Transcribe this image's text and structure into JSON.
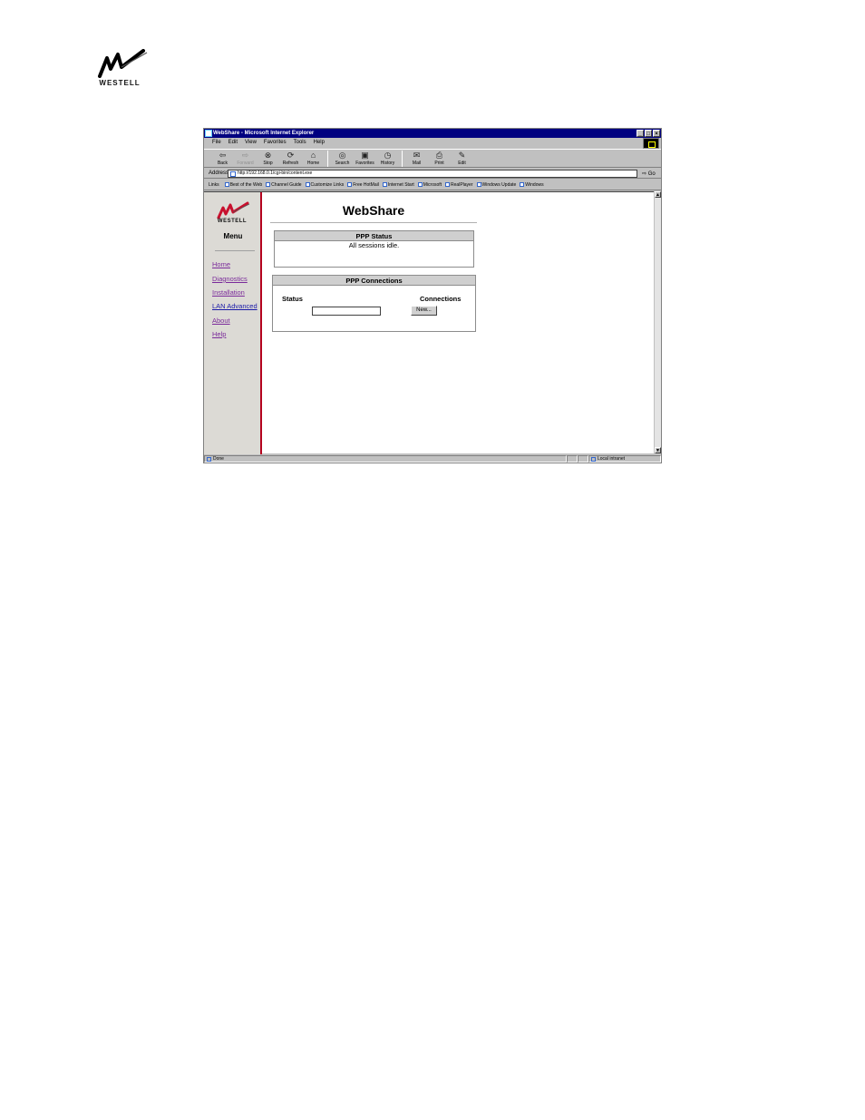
{
  "brand": {
    "name": "WESTELL"
  },
  "window": {
    "title": "WebShare - Microsoft Internet Explorer",
    "controls": [
      "_",
      "□",
      "×"
    ]
  },
  "menubar": [
    "File",
    "Edit",
    "View",
    "Favorites",
    "Tools",
    "Help"
  ],
  "toolbar": [
    {
      "label": "Back",
      "icon": "back-arrow-icon"
    },
    {
      "label": "Forward",
      "icon": "forward-arrow-icon"
    },
    {
      "label": "Stop",
      "icon": "stop-icon"
    },
    {
      "label": "Refresh",
      "icon": "refresh-icon"
    },
    {
      "label": "Home",
      "icon": "home-icon"
    },
    {
      "label": "Search",
      "icon": "search-icon"
    },
    {
      "label": "Favorites",
      "icon": "favorites-icon"
    },
    {
      "label": "History",
      "icon": "history-icon"
    },
    {
      "label": "Mail",
      "icon": "mail-icon"
    },
    {
      "label": "Print",
      "icon": "print-icon"
    },
    {
      "label": "Edit",
      "icon": "edit-icon"
    }
  ],
  "address": {
    "label": "Address",
    "url": "http://192.168.0.1/cgi-bin/content.exe",
    "go": "Go"
  },
  "links": {
    "label": "Links",
    "items": [
      "Best of the Web",
      "Channel Guide",
      "Customize Links",
      "Free HotMail",
      "Internet Start",
      "Microsoft",
      "RealPlayer",
      "Windows Update",
      "Windows"
    ]
  },
  "sidebar": {
    "logo": "WESTELL",
    "menu_title": "Menu",
    "items": [
      "Home",
      "Diagnostics",
      "Installation",
      "LAN Advanced",
      "About",
      "Help"
    ]
  },
  "main": {
    "title": "WebShare",
    "ppp_status": {
      "header": "PPP Status",
      "text": "All sessions idle."
    },
    "ppp_connections": {
      "header": "PPP Connections",
      "status_label": "Status",
      "connections_label": "Connections",
      "new_button": "New..."
    }
  },
  "statusbar": {
    "left": "Done",
    "zone": "Local intranet"
  }
}
